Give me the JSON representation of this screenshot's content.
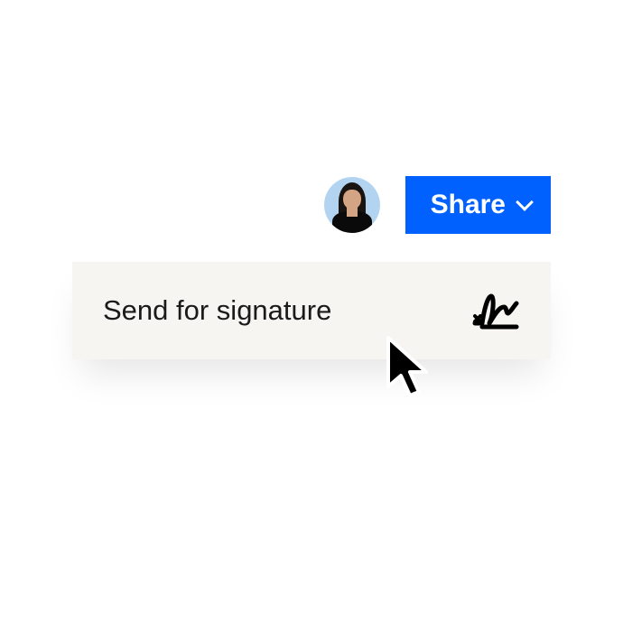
{
  "header": {
    "share_label": "Share"
  },
  "dropdown": {
    "send_for_signature_label": "Send for signature"
  },
  "colors": {
    "primary": "#0061FE",
    "panel": "#F7F5F2"
  }
}
